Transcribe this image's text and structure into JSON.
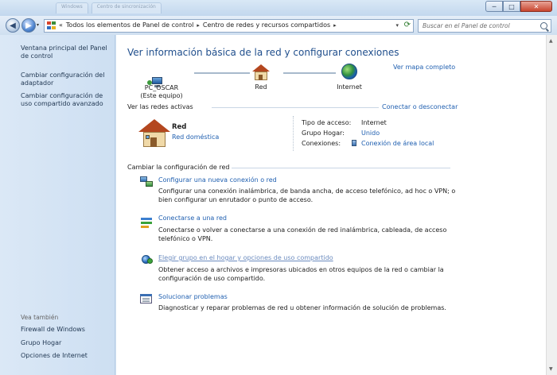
{
  "window": {
    "minimize_glyph": "─",
    "maximize_glyph": "□",
    "close_glyph": "✕",
    "tabs_ghost": [
      "Windows",
      "Centro de sincronización"
    ]
  },
  "address": {
    "crumb_prefix": "«",
    "crumbs": [
      "Todos los elementos de Panel de control",
      "Centro de redes y recursos compartidos"
    ],
    "separator": "▸",
    "search_placeholder": "Buscar en el Panel de control"
  },
  "sidebar": {
    "links": [
      "Ventana principal del Panel de control",
      "Cambiar configuración del adaptador",
      "Cambiar configuración de uso compartido avanzado"
    ],
    "see_also_heading": "Vea también",
    "see_also": [
      "Firewall de Windows",
      "Grupo Hogar",
      "Opciones de Internet"
    ]
  },
  "main": {
    "title": "Ver información básica de la red y configurar conexiones",
    "full_map_link": "Ver mapa completo",
    "map": {
      "computer_name": "PC_OSCAR",
      "computer_sub": "(Este equipo)",
      "network": "Red",
      "internet": "Internet"
    },
    "active_networks": {
      "heading": "Ver las redes activas",
      "connect_link": "Conectar o desconectar",
      "network_name": "Red",
      "network_type": "Red doméstica",
      "access_type_label": "Tipo de acceso:",
      "access_type_value": "Internet",
      "homegroup_label": "Grupo Hogar:",
      "homegroup_value": "Unido",
      "connections_label": "Conexiones:",
      "connections_value": "Conexión de área local"
    },
    "change_settings": {
      "heading": "Cambiar la configuración de red",
      "tasks": [
        {
          "title": "Configurar una nueva conexión o red",
          "desc": "Configurar una conexión inalámbrica, de banda ancha, de acceso telefónico, ad hoc o VPN; o bien configurar un enrutador o punto de acceso."
        },
        {
          "title": "Conectarse a una red",
          "desc": "Conectarse o volver a conectarse a una conexión de red inalámbrica, cableada, de acceso telefónico o VPN."
        },
        {
          "title": "Elegir grupo en el hogar y opciones de uso compartido",
          "desc": "Obtener acceso a archivos e impresoras ubicados en otros equipos de la red o cambiar la configuración de uso compartido."
        },
        {
          "title": "Solucionar problemas",
          "desc": "Diagnosticar y reparar problemas de red u obtener información de solución de problemas."
        }
      ]
    }
  },
  "colors": {
    "link": "#1f5fb0",
    "title": "#1f4e8c",
    "sidebar_bg": "#d5e5f5"
  }
}
